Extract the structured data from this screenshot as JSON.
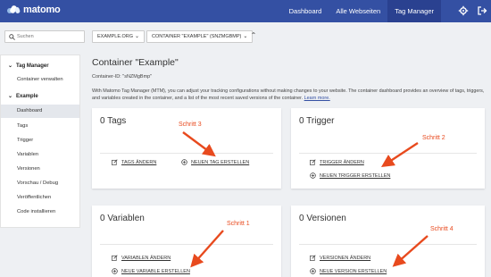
{
  "header": {
    "logo_text": "matomo",
    "nav": [
      "Dashboard",
      "Alle Webseiten",
      "Tag Manager"
    ]
  },
  "filters": {
    "search_placeholder": "Suchen",
    "site_select": "EXAMPLE.ORG",
    "container_select": "CONTAINER \"EXAMPLE\" (SNZMGBMP)"
  },
  "sidebar": {
    "section1": "Tag Manager",
    "item_container": "Container verwalten",
    "section2": "Example",
    "items": [
      "Dashboard",
      "Tags",
      "Trigger",
      "Variablen",
      "Versionen",
      "Vorschau / Debug",
      "Veröffentlichen",
      "Code installieren"
    ]
  },
  "main": {
    "title": "Container \"Example\"",
    "container_id": "Container-ID: \"sNZMgBmp\"",
    "intro": "With Matomo Tag Manager (MTM), you can adjust your tracking configurations without making changes to your website. The container dashboard provides an overview of tags, triggers, and variables created in the container, and a list of the most recent saved versions of the container.",
    "learn_more": "Learn more."
  },
  "cards": {
    "tags": {
      "title": "0 Tags",
      "edit": "TAGS ÄNDERN",
      "create": "NEUEN TAG ERSTELLEN"
    },
    "trigger": {
      "title": "0 Trigger",
      "edit": "TRIGGER ÄNDERN",
      "create": "NEUEN TRIGGER ERSTELLEN"
    },
    "variables": {
      "title": "0 Variablen",
      "edit": "VARIABLEN ÄNDERN",
      "create": "NEUE VARIABLE ERSTELLEN"
    },
    "versions": {
      "title": "0 Versionen",
      "edit": "VERSIONEN ÄNDERN",
      "create": "NEUE VERSION ERSTELLEN"
    }
  },
  "annotations": {
    "step1": "Schritt 1",
    "step2": "Schritt 2",
    "step3": "Schritt 3",
    "step4": "Schritt 4",
    "color": "#e84a1e"
  },
  "colors": {
    "header": "#3450a3",
    "accent_link": "#3450a3"
  }
}
